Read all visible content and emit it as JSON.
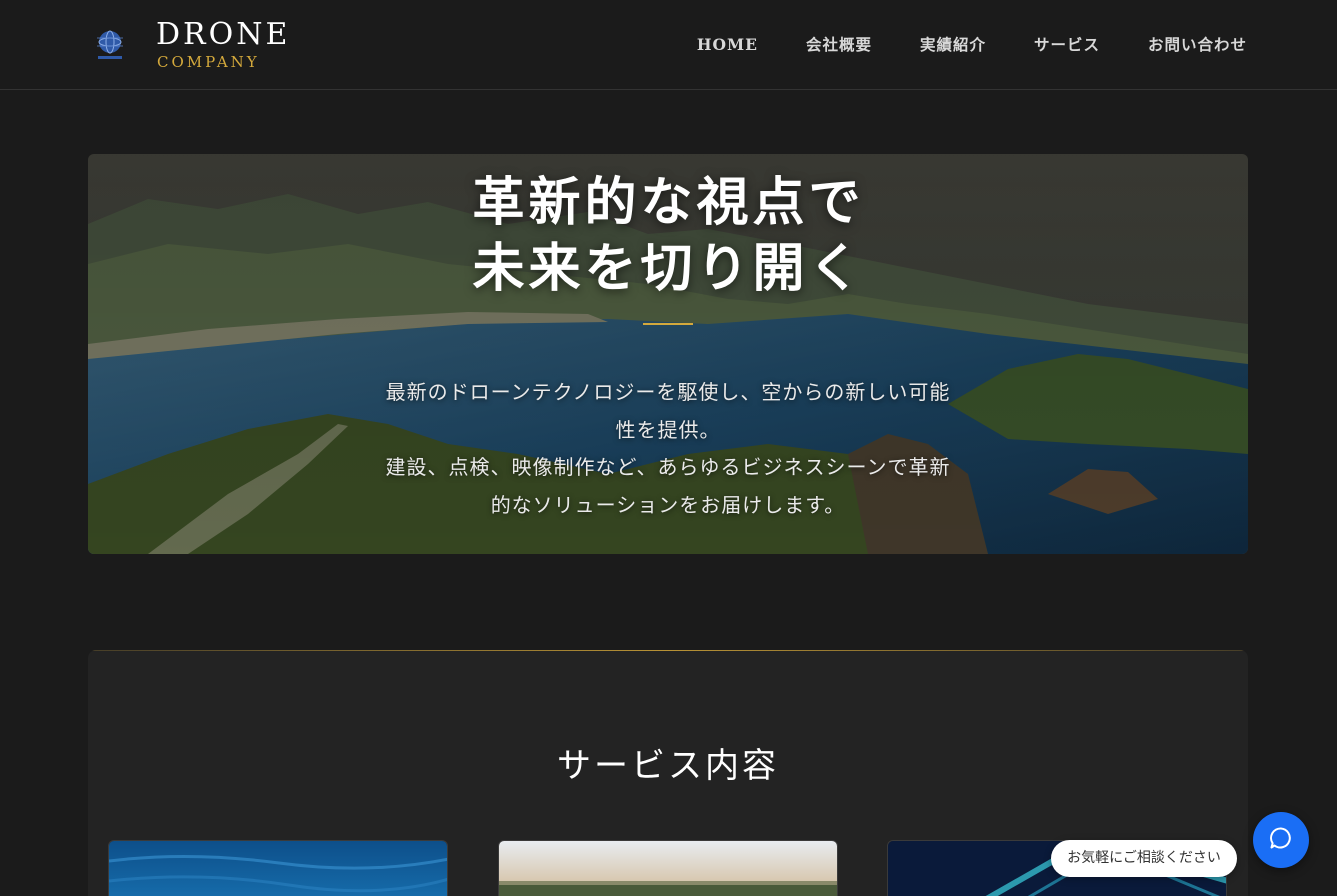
{
  "header": {
    "brand_name": "DRONE",
    "brand_sub": "COMPANY",
    "logo_icon": "globe-drone-logo"
  },
  "nav": {
    "items": [
      {
        "label": "HOME"
      },
      {
        "label": "会社概要"
      },
      {
        "label": "実績紹介"
      },
      {
        "label": "サービス"
      },
      {
        "label": "お問い合わせ"
      }
    ]
  },
  "hero": {
    "title_line1": "革新的な視点で",
    "title_line2": "未来を切り開く",
    "desc_line1": "最新のドローンテクノロジーを駆使し、空からの新しい可能",
    "desc_line2": "性を提供。",
    "desc_line3": "建設、点検、映像制作など、あらゆるビジネスシーンで革新",
    "desc_line4": "的なソリューションをお届けします。"
  },
  "services": {
    "title": "サービス内容"
  },
  "chat": {
    "bubble_text": "お気軽にご相談ください",
    "icon": "chat-icon"
  },
  "colors": {
    "accent_gold": "#d4a93c",
    "background": "#1b1b1b",
    "chat_blue": "#1a6ef5"
  }
}
